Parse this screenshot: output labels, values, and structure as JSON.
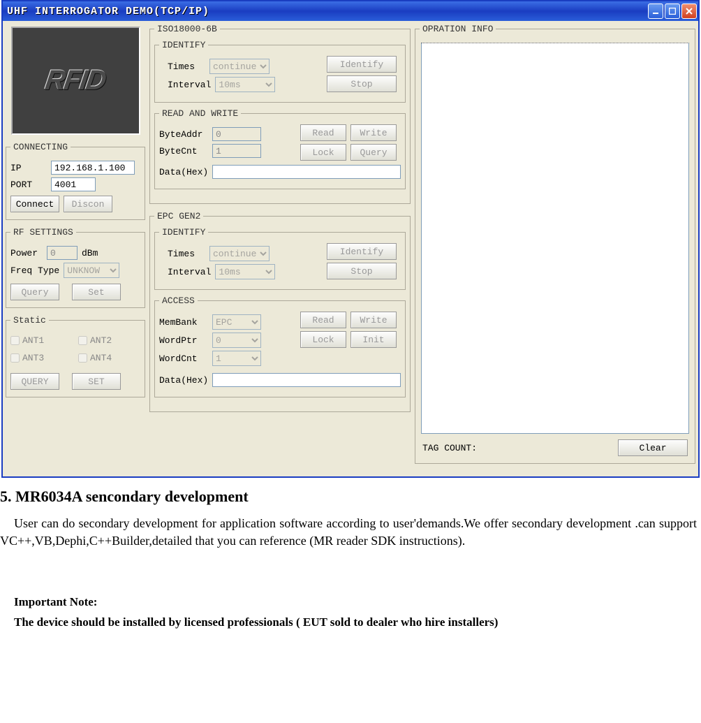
{
  "window": {
    "title": "UHF INTERROGATOR DEMO(TCP/IP)",
    "logo_text": "RFID"
  },
  "connecting": {
    "legend": "CONNECTING",
    "ip_label": "IP",
    "ip_value": "192.168.1.100",
    "port_label": "PORT",
    "port_value": "4001",
    "connect_btn": "Connect",
    "discon_btn": "Discon"
  },
  "rf": {
    "legend": "RF SETTINGS",
    "power_label": "Power",
    "power_value": "0",
    "power_unit": "dBm",
    "freqtype_label": "Freq Type",
    "freqtype_value": "UNKNOW",
    "query_btn": "Query",
    "set_btn": "Set"
  },
  "staticbox": {
    "legend": "Static",
    "ant1": "ANT1",
    "ant2": "ANT2",
    "ant3": "ANT3",
    "ant4": "ANT4",
    "query_btn": "QUERY",
    "set_btn": "SET"
  },
  "iso": {
    "legend": "ISO18000-6B",
    "identify": {
      "legend": "IDENTIFY",
      "times_label": "Times",
      "times_value": "continue",
      "interval_label": "Interval",
      "interval_value": "10ms",
      "identify_btn": "Identify",
      "stop_btn": "Stop"
    },
    "rw": {
      "legend": "READ AND WRITE",
      "byteaddr_label": "ByteAddr",
      "byteaddr_value": "0",
      "bytecnt_label": "ByteCnt",
      "bytecnt_value": "1",
      "data_label": "Data(Hex)",
      "read_btn": "Read",
      "write_btn": "Write",
      "lock_btn": "Lock",
      "query_btn": "Query"
    }
  },
  "epc": {
    "legend": "EPC GEN2",
    "identify": {
      "legend": "IDENTIFY",
      "times_label": "Times",
      "times_value": "continue",
      "interval_label": "Interval",
      "interval_value": "10ms",
      "identify_btn": "Identify",
      "stop_btn": "Stop"
    },
    "access": {
      "legend": "ACCESS",
      "membank_label": "MemBank",
      "membank_value": "EPC",
      "wordptr_label": "WordPtr",
      "wordptr_value": "0",
      "wordcnt_label": "WordCnt",
      "wordcnt_value": "1",
      "data_label": "Data(Hex)",
      "read_btn": "Read",
      "write_btn": "Write",
      "lock_btn": "Lock",
      "init_btn": "Init"
    }
  },
  "opr": {
    "legend": "OPRATION INFO",
    "tagcount_label": "TAG COUNT:",
    "clear_btn": "Clear"
  },
  "doc": {
    "heading": "5.   MR6034A sencondary development",
    "paragraph": "User can do secondary development for application software according to user'demands.We offer secondary development .can support VC++,VB,Dephi,C++Builder,detailed that you can reference (MR reader SDK instructions).",
    "note_title": "Important Note:",
    "note_body": "The device should be installed by licensed professionals ( EUT sold to dealer who hire installers)"
  }
}
